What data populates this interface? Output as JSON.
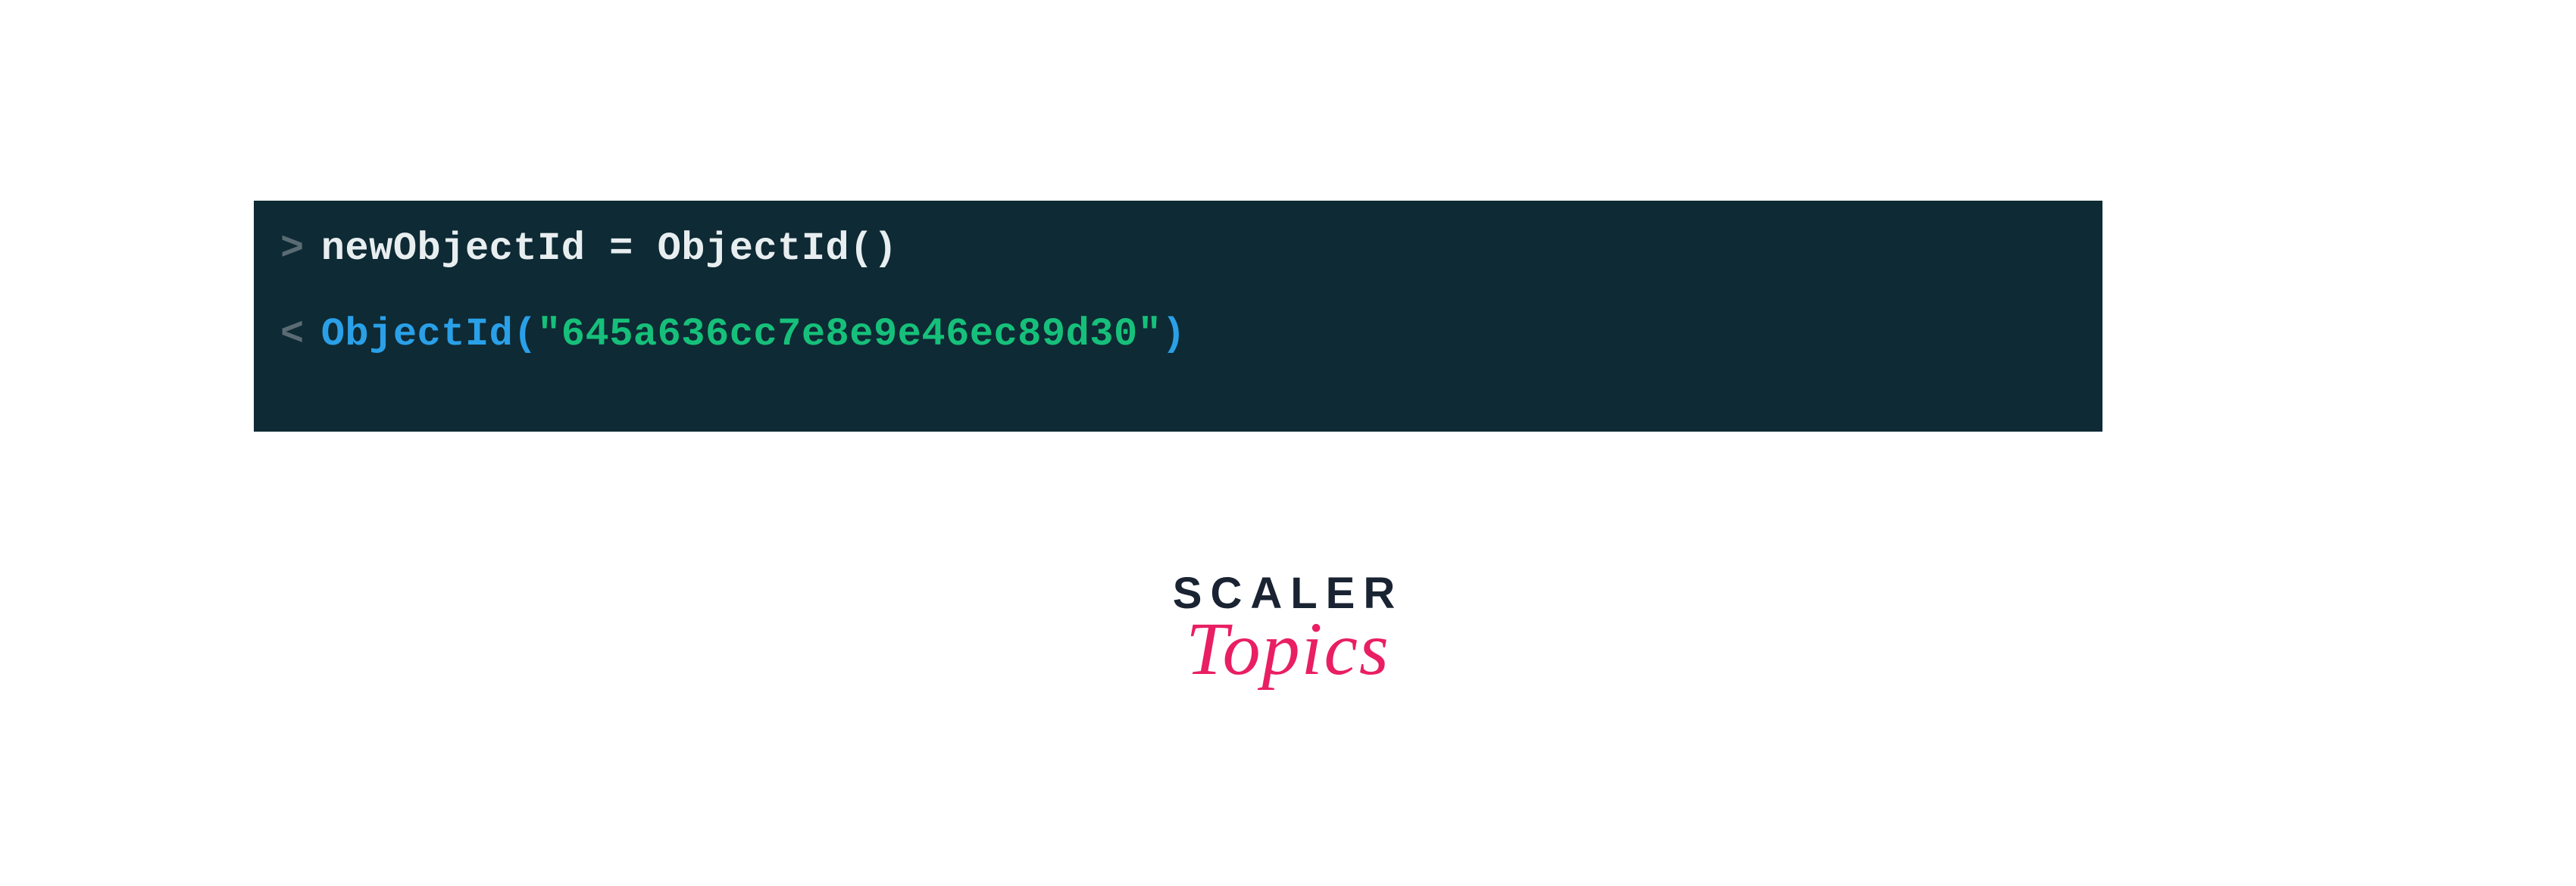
{
  "terminal": {
    "input": {
      "prompt": ">",
      "code": "newObjectId = ObjectId()"
    },
    "output": {
      "prompt": "<",
      "func": "ObjectId",
      "open_paren": "(",
      "value": "\"645a636cc7e8e9e46ec89d30\"",
      "close_paren": ")"
    }
  },
  "logo": {
    "top": "SCALER",
    "bottom": "Topics"
  },
  "colors": {
    "terminal_bg": "#0e2a34",
    "prompt": "#5a6b74",
    "text": "#e8eef0",
    "keyword": "#2aa0e8",
    "string": "#16c07a",
    "logo_dark": "#1a2332",
    "logo_pink": "#e91e63"
  }
}
